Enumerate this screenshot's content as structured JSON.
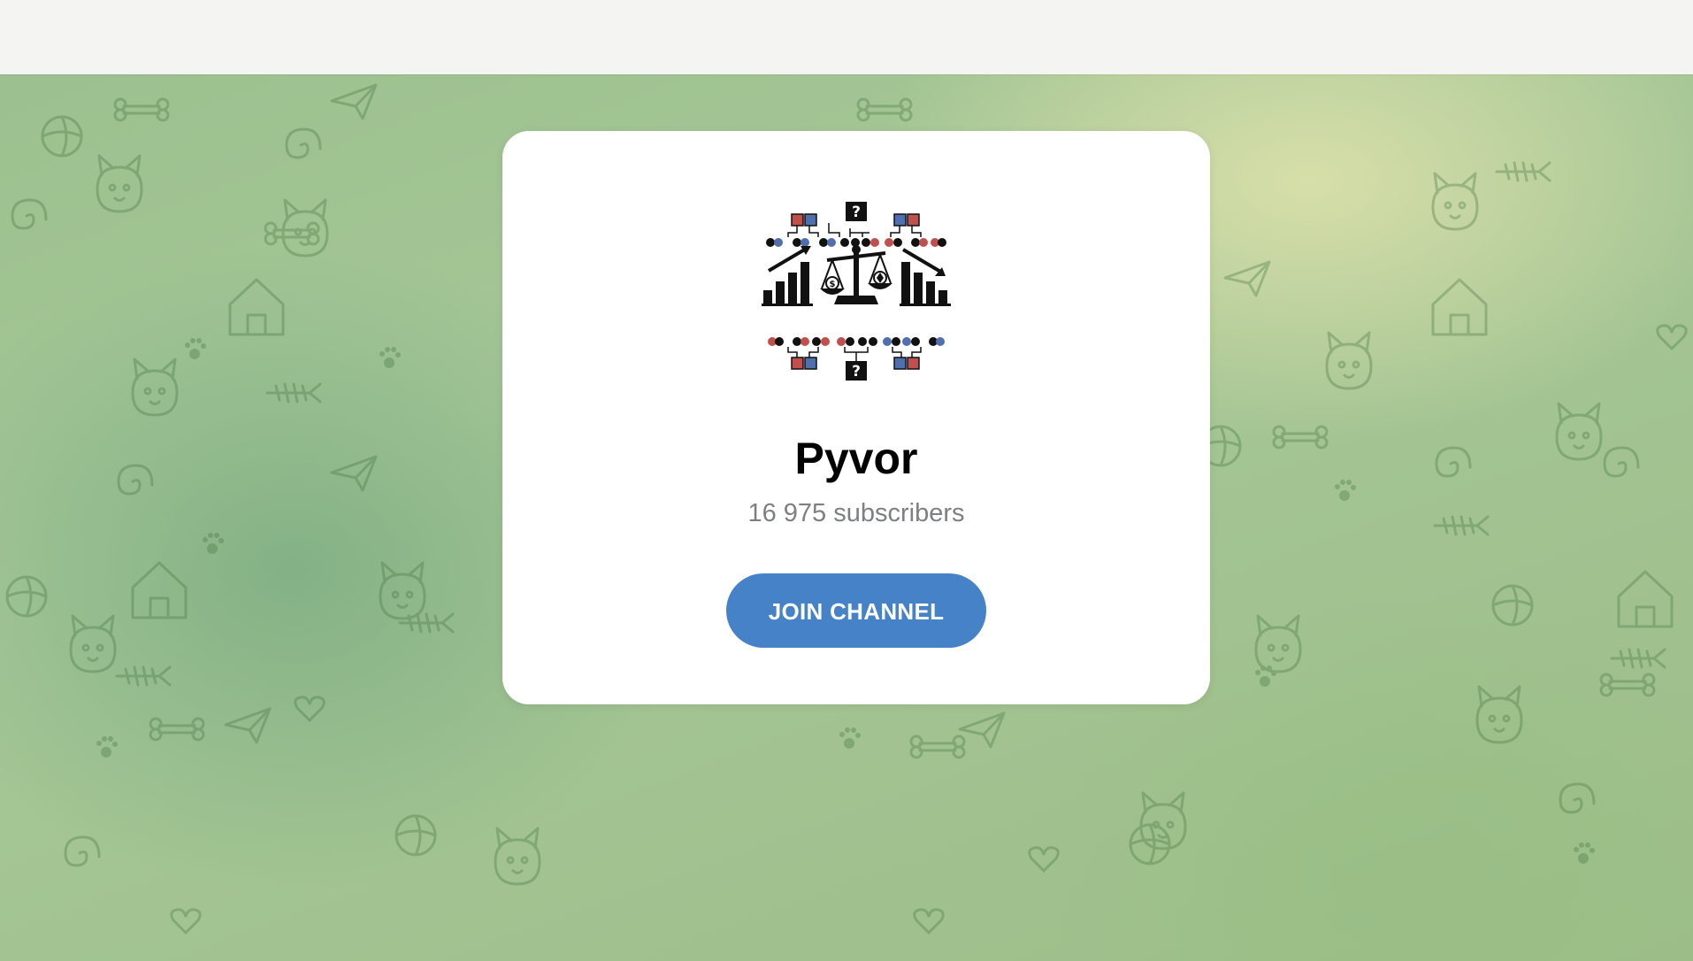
{
  "channel": {
    "title": "Pyvor",
    "subscribers": "16 975 subscribers",
    "join_label": "JOIN CHANNEL"
  },
  "colors": {
    "accent": "#4682c8",
    "topbar": "#f4f4f3",
    "card": "#ffffff",
    "subtitle": "#7d7f81",
    "background_green": "#a2c391"
  },
  "icons": {
    "avatar": "scales-and-charts-logo",
    "background": "doodle-pattern"
  }
}
